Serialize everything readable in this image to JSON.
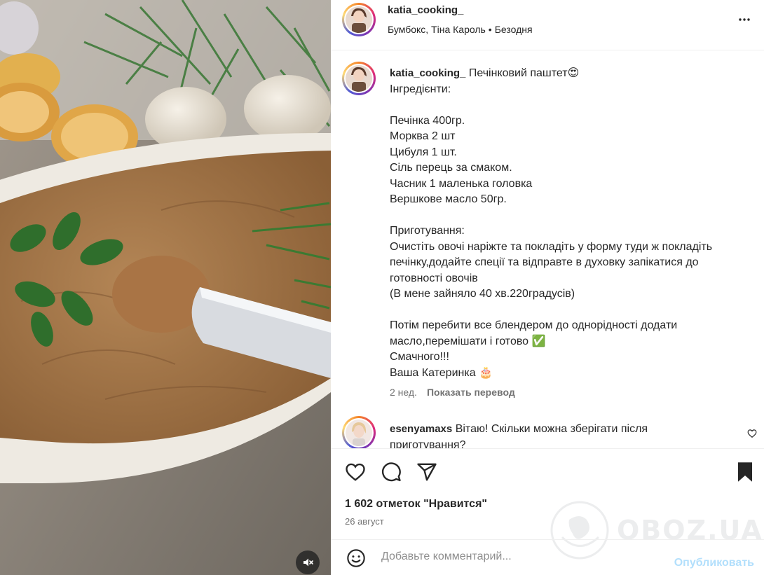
{
  "header": {
    "username": "katia_cooking_",
    "audio_artist": "Бумбокс, Тіна Кароль",
    "separator": "•",
    "audio_track": "Безодня",
    "more_icon": "more-horizontal-icon"
  },
  "caption": {
    "username": "katia_cooking_",
    "title": "Печінковий паштет",
    "title_emoji": "😍",
    "lines": [
      "Інгредієнти:",
      "",
      "Печінка 400гр.",
      "Морква 2 шт",
      "Цибуля 1 шт.",
      "Сіль перець за смаком.",
      "Часник 1 маленька головка",
      "Вершкове масло 50гр.",
      "",
      "Приготування:",
      "Очистіть овочі наріжте та покладіть у форму туди ж покладіть печінку,додайте спеції та відправте в духовку запікатися до готовності овочів",
      "(В мене зайняло 40 хв.220градусів)",
      "",
      "Потім перебити все блендером до однорідності додати масло,перемішати і готово ✅",
      "Смачного!!!",
      "Ваша Катеринка 🎂"
    ],
    "time_ago": "2 нед.",
    "translate_label": "Показать перевод"
  },
  "comments": [
    {
      "username": "esenyamaxs",
      "text": "Вітаю! Скільки можна зберігати після приготування?"
    }
  ],
  "actions": {
    "like_icon": "heart-icon",
    "comment_icon": "comment-icon",
    "share_icon": "send-icon",
    "save_icon": "bookmark-icon"
  },
  "likes": {
    "text": "1 602 отметок \"Нравится\""
  },
  "post_date": "26 август",
  "comment_bar": {
    "emoji_icon": "emoji-icon",
    "placeholder": "Добавьте комментарий...",
    "publish_label": "Опубликовать"
  },
  "media": {
    "mute_icon": "speaker-muted-icon"
  },
  "watermark": {
    "text": "OBOZ.UA"
  }
}
